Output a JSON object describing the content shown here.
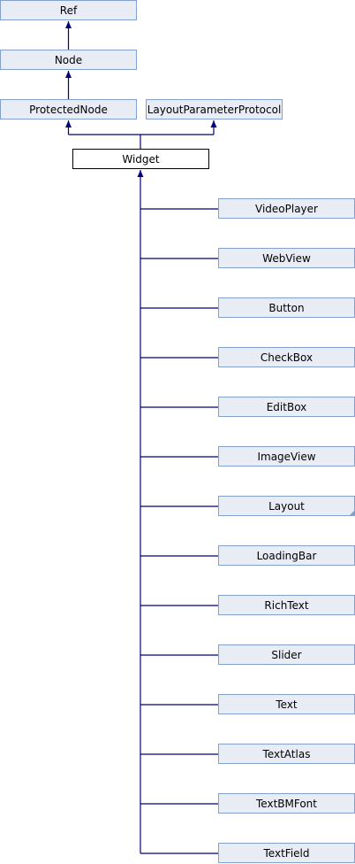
{
  "colors": {
    "box_fill": "#e8ecf5",
    "box_border": "#84a0d0",
    "focus_fill": "#ffffff",
    "focus_border": "#000000",
    "edge": "#000080"
  },
  "ancestors": [
    {
      "id": "ref",
      "label": "Ref"
    },
    {
      "id": "node",
      "label": "Node"
    },
    {
      "id": "protectednode",
      "label": "ProtectedNode"
    },
    {
      "id": "layoutparameterprotocol",
      "label": "LayoutParameterProtocol"
    }
  ],
  "focus": {
    "label": "Widget"
  },
  "children": [
    {
      "label": "VideoPlayer",
      "has_more": false
    },
    {
      "label": "WebView",
      "has_more": false
    },
    {
      "label": "Button",
      "has_more": false
    },
    {
      "label": "CheckBox",
      "has_more": false
    },
    {
      "label": "EditBox",
      "has_more": false
    },
    {
      "label": "ImageView",
      "has_more": false
    },
    {
      "label": "Layout",
      "has_more": true
    },
    {
      "label": "LoadingBar",
      "has_more": false
    },
    {
      "label": "RichText",
      "has_more": false
    },
    {
      "label": "Slider",
      "has_more": false
    },
    {
      "label": "Text",
      "has_more": false
    },
    {
      "label": "TextAtlas",
      "has_more": false
    },
    {
      "label": "TextBMFont",
      "has_more": false
    },
    {
      "label": "TextField",
      "has_more": false
    }
  ]
}
